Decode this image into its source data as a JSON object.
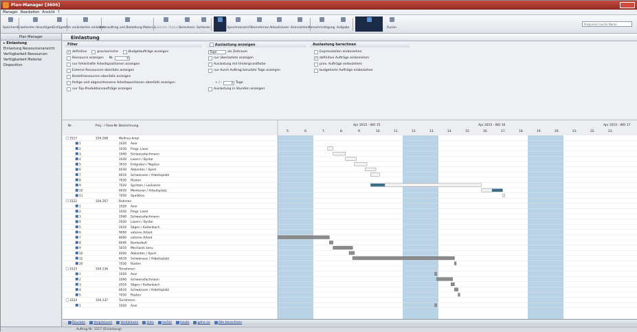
{
  "window": {
    "title": "Plan-Manager [3606]"
  },
  "menu": [
    "Manager",
    "Bearbeiten",
    "Ansicht",
    "?"
  ],
  "toolbar": [
    {
      "label": "Speichern",
      "icon": "save-icon",
      "dim": false
    },
    {
      "label": "Erweitertes Hinzufügen",
      "icon": "add-icon",
      "dim": false
    },
    {
      "label": "Einfügen",
      "icon": "insert-icon",
      "dim": false
    },
    {
      "label": "Alle veränderten einlasten",
      "icon": "load-icon",
      "dim": false
    },
    {
      "label": "Unterauftrag und Bestellung Material",
      "icon": "order-icon",
      "dim": false
    },
    {
      "label": "Spätester Status",
      "icon": "status-icon",
      "dim": true
    },
    {
      "label": "Berechnen",
      "icon": "calc-icon",
      "dim": false
    },
    {
      "label": "Sortieren",
      "icon": "sort-icon",
      "dim": false
    },
    {
      "label": "",
      "icon": "grid-icon",
      "dim": false,
      "dark": true
    },
    {
      "label": "Synchronisiert",
      "icon": "sync-icon",
      "dim": false
    },
    {
      "label": "Übernehmen",
      "icon": "apply-icon",
      "dim": false
    },
    {
      "label": "Aktualisieren",
      "icon": "refresh-icon",
      "dim": false
    },
    {
      "label": "Kennzahlen",
      "icon": "kpi-icon",
      "dim": false
    },
    {
      "label": "Benachrichtigung",
      "icon": "bell-icon",
      "dim": false
    },
    {
      "label": "Aufgabe",
      "icon": "task-icon",
      "dim": false
    },
    {
      "label": "",
      "icon": "view-icon",
      "dim": false,
      "dark": true
    },
    {
      "label": "Fusion",
      "icon": "fusion-icon",
      "dim": false
    }
  ],
  "search": {
    "placeholder": "Programm-Suche Name"
  },
  "sidebar": {
    "header": "Plan-Manager",
    "items": [
      "Einlastung",
      "Einlastung Ressourcenansicht",
      "Verfügbarkeit Ressourcen",
      "Verfügbarkeit Material",
      "Disposition"
    ]
  },
  "main": {
    "title": "Einlastung"
  },
  "filter": {
    "title": "Filter",
    "statusOptions": [
      {
        "label": "definitive",
        "checked": true
      },
      {
        "label": "provisorische",
        "checked": false
      },
      {
        "label": "Budgetaufträge anzeigen",
        "checked": false
      }
    ],
    "ressource": {
      "label": "Ressource anzeigen",
      "field_prefix": "Nr.",
      "value": "0"
    },
    "options": [
      "nur fehlerhafte Arbeitspositionen anzeigen",
      "Externe Ressourcen ebenfalls anzeigen",
      "Bestellressourcen ebenfalls anzeigen",
      "fertige und abgeschlossene Arbeitspositionen ebenfalls anzeigen",
      "nur Top-Produktionsaufträge anzeigen"
    ]
  },
  "auslastung": {
    "title": "Auslastung anzeigen",
    "unit": "Tage",
    "unit_suffix": "als Zeitraum",
    "options": [
      "nur überlastete anzeigen",
      "Auslastung mit Hintergrundfarbe",
      "nur durch Auftrag benutzte Tage anzeigen"
    ],
    "plusminus": {
      "prefix": "+ / -",
      "value": "3",
      "suffix": "Tage"
    },
    "hours": "Auslastung in Stunden anzeigen"
  },
  "berechnen": {
    "title": "Auslastung berechnen",
    "options": [
      {
        "label": "Expresszeiten einbeziehen",
        "checked": false
      },
      {
        "label": "definitive Aufträge einbeziehen",
        "checked": true
      },
      {
        "label": "prov. Aufträge einbeziehen",
        "checked": false
      },
      {
        "label": "budgetierte Aufträge einbeziehen",
        "checked": false
      }
    ]
  },
  "gantt": {
    "columns": {
      "nr": "Nr.",
      "proj": "Proj.- / Fasa-Nr.",
      "desc": "Bezeichnung"
    },
    "weeks": [
      "Apr 2015 - WO 15",
      "Apr 2015 - WO 16",
      "Apr 2015 - WO 17"
    ],
    "days": [
      "5.",
      "6.",
      "7.",
      "8.",
      "9.",
      "10.",
      "11.",
      "12.",
      "13.",
      "14.",
      "15.",
      "16.",
      "17.",
      "18.",
      "19.",
      "20.",
      "21.",
      "22.",
      "23."
    ],
    "rows": [
      {
        "level": 0,
        "nr": "1517",
        "proj": "104.268",
        "code": "",
        "desc": "Wellnes-kmpl.",
        "bar": null,
        "grey": true
      },
      {
        "level": 1,
        "nr": "1",
        "proj": "",
        "code": "1020",
        "desc": "Avor",
        "bar": null,
        "grey": true
      },
      {
        "level": 1,
        "nr": "2",
        "proj": "",
        "code": "1030",
        "desc": "Progr. Laser",
        "bar": [
          2.8,
          3.1,
          "w"
        ]
      },
      {
        "level": 1,
        "nr": "3",
        "proj": "",
        "code": "1040",
        "desc": "Schweissfachmann",
        "bar": [
          3.1,
          3.8,
          "w"
        ]
      },
      {
        "level": 1,
        "nr": "4",
        "proj": "",
        "code": "2030",
        "desc": "Lasern / Bystar",
        "bar": [
          3.8,
          4.4,
          "w"
        ]
      },
      {
        "level": 1,
        "nr": "5",
        "proj": "",
        "code": "3010",
        "desc": "Entgraten / Neptun",
        "bar": [
          4.3,
          5.0,
          "w"
        ]
      },
      {
        "level": 1,
        "nr": "6",
        "proj": "",
        "code": "4030",
        "desc": "Abkanten / Xpert",
        "bar": [
          4.9,
          5.5,
          "w"
        ]
      },
      {
        "level": 1,
        "nr": "7",
        "proj": "",
        "code": "6010",
        "desc": "Schweissen / Arbeitsplatz",
        "bar": [
          5.2,
          5.7,
          "w"
        ]
      },
      {
        "level": 1,
        "nr": "8",
        "proj": "",
        "code": "7030",
        "desc": "Rüsten",
        "bar": null
      },
      {
        "level": 1,
        "nr": "9",
        "proj": "",
        "code": "7020",
        "desc": "Spritzen / Lackieren",
        "bar": [
          5.2,
          11.4,
          "wt"
        ]
      },
      {
        "level": 1,
        "nr": "10",
        "proj": "",
        "code": "6030",
        "desc": "Montieren / Arbeitsplatz",
        "bar": [
          11.4,
          12.6,
          "wt2"
        ]
      },
      {
        "level": 1,
        "nr": "11",
        "proj": "",
        "code": "7050",
        "desc": "Spedition",
        "bar": [
          12.6,
          12.7,
          "w"
        ]
      },
      {
        "level": 0,
        "nr": "1522",
        "proj": "104.267",
        "code": "",
        "desc": "Rahmen",
        "bar": null
      },
      {
        "level": 1,
        "nr": "1",
        "proj": "",
        "code": "1020",
        "desc": "Avor",
        "bar": null
      },
      {
        "level": 1,
        "nr": "2",
        "proj": "",
        "code": "1030",
        "desc": "Progr. Laser",
        "bar": null
      },
      {
        "level": 1,
        "nr": "3",
        "proj": "",
        "code": "1040",
        "desc": "Schweissfachmann",
        "bar": null
      },
      {
        "level": 1,
        "nr": "4",
        "proj": "",
        "code": "2030",
        "desc": "Lasern / Bystar",
        "bar": null
      },
      {
        "level": 1,
        "nr": "5",
        "proj": "",
        "code": "2010",
        "desc": "Sägen / Kaltenbach",
        "bar": null
      },
      {
        "level": 1,
        "nr": "6",
        "proj": "",
        "code": "9000",
        "desc": "externe Arbeit",
        "bar": null
      },
      {
        "level": 1,
        "nr": "7",
        "proj": "",
        "code": "8000",
        "desc": "externe Arbeit",
        "bar": [
          0.0,
          2.9,
          "g"
        ]
      },
      {
        "level": 1,
        "nr": "8",
        "proj": "",
        "code": "6040",
        "desc": "Bankarbeit",
        "bar": [
          2.9,
          3.1,
          "g"
        ]
      },
      {
        "level": 1,
        "nr": "9",
        "proj": "",
        "code": "5010",
        "desc": "Mechanik konv.",
        "bar": [
          3.1,
          4.2,
          "g"
        ]
      },
      {
        "level": 1,
        "nr": "10",
        "proj": "",
        "code": "4040",
        "desc": "Abkanten / Xpert",
        "bar": [
          4.0,
          4.3,
          "g"
        ]
      },
      {
        "level": 1,
        "nr": "12",
        "proj": "",
        "code": "6010",
        "desc": "Schweissen / Arbeitsplatz",
        "bar": [
          4.2,
          9.9,
          "g"
        ]
      },
      {
        "level": 1,
        "nr": "20",
        "proj": "",
        "code": "7030",
        "desc": "Rüsten",
        "bar": [
          9.9,
          10.0,
          "g"
        ]
      },
      {
        "level": 0,
        "nr": "1523",
        "proj": "104.136",
        "code": "",
        "desc": "Türrahmen",
        "bar": null
      },
      {
        "level": 1,
        "nr": "1",
        "proj": "",
        "code": "1020",
        "desc": "Avor",
        "bar": [
          8.8,
          8.9,
          "g"
        ]
      },
      {
        "level": 1,
        "nr": "2",
        "proj": "",
        "code": "1040",
        "desc": "Schweissfachmann",
        "bar": [
          8.9,
          9.8,
          "g"
        ]
      },
      {
        "level": 1,
        "nr": "3",
        "proj": "",
        "code": "2010",
        "desc": "Sägen / Kaltenbach",
        "bar": [
          9.7,
          9.9,
          "g"
        ]
      },
      {
        "level": 1,
        "nr": "4",
        "proj": "",
        "code": "6010",
        "desc": "Schweissen / Arbeitsplatz",
        "bar": [
          9.9,
          10.1,
          "g"
        ]
      },
      {
        "level": 1,
        "nr": "5",
        "proj": "",
        "code": "7030",
        "desc": "Rüsten",
        "bar": [
          10.1,
          10.2,
          "g"
        ]
      },
      {
        "level": 0,
        "nr": "1524",
        "proj": "104.137",
        "code": "",
        "desc": "Türrahmen",
        "bar": null
      },
      {
        "level": 1,
        "nr": "1",
        "proj": "",
        "code": "1020",
        "desc": "Avor",
        "bar": [
          8.8,
          8.9,
          "g"
        ]
      }
    ],
    "weekendDays": [
      0,
      1,
      7,
      8,
      14,
      15
    ]
  },
  "bottom": [
    {
      "label": "Drucken",
      "icon": "print-icon"
    },
    {
      "label": "Vergrössern",
      "icon": "zoom-in-icon"
    },
    {
      "label": "Verkleinern",
      "icon": "zoom-out-icon"
    },
    {
      "label": "links",
      "icon": "left-icon"
    },
    {
      "label": "rechts",
      "icon": "right-icon"
    },
    {
      "label": "heute",
      "icon": "today-icon"
    },
    {
      "label": "gehe zu",
      "icon": "goto-icon"
    },
    {
      "label": "Alle berechnen",
      "icon": "calc-all-icon"
    }
  ],
  "status": {
    "text": "Auftrag Nr. 1517 (Einlastung)"
  },
  "colors": {
    "weekend": "#b9d3e6",
    "barWhite": "#f4f4f4",
    "barGrey": "#8c8c8c",
    "barTeal": "#3c6f86"
  }
}
